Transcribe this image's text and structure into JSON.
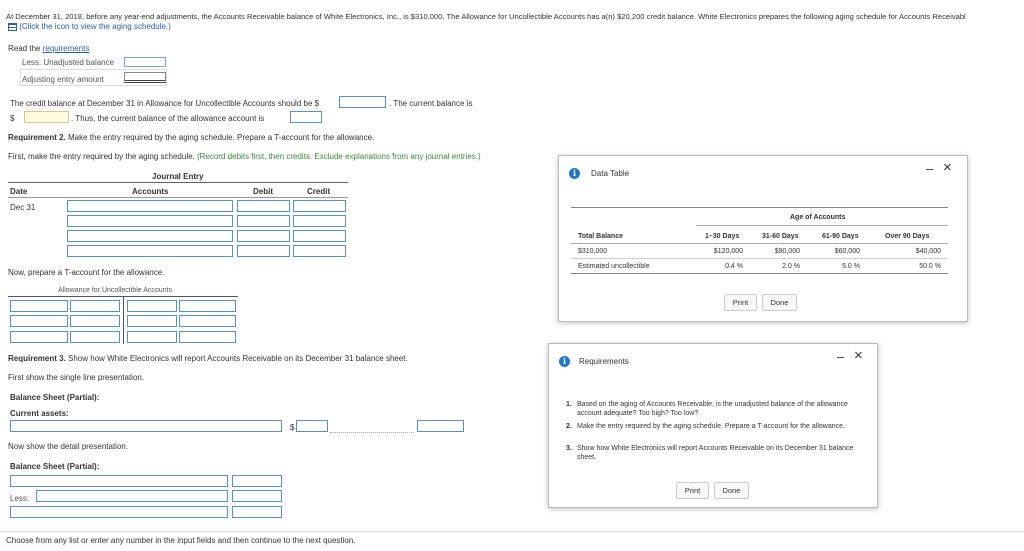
{
  "header": {
    "problem_text": "At December 31, 2018, before any year-end adjustments, the Accounts Receivable balance of White Electronics, Inc., is $310,000. The Allowance for Uncollectible Accounts has a(n) $20,200 credit balance. White Electronics prepares the following aging schedule for Accounts Receivabl",
    "icon_link_text": "(Click the icon to view the aging schedule.)",
    "read_label": "Read the ",
    "requirements_link": "requirements"
  },
  "req1": {
    "less_unadjusted": "Less: Unadjusted balance",
    "adjusting_entry": "Adjusting entry amount",
    "credit_balance_text": "The credit balance at December 31 in Allowance for Uncollectible Accounts should be $",
    "current_balance_text": ". The current balance is",
    "dollar": "$",
    "thus_text": ". Thus, the current balance of the allowance account is"
  },
  "req2": {
    "heading_bold": "Requirement 2.",
    "heading_rest": " Make the entry required by the aging schedule. Prepare a T-account for the allowance.",
    "instruction_start": "First, make the entry required by the aging schedule. ",
    "instruction_green": "(Record debits first, then credits. Exclude explanations from any journal entries.)",
    "journal_title": "Journal Entry",
    "col_date": "Date",
    "col_accounts": "Accounts",
    "col_debit": "Debit",
    "col_credit": "Credit",
    "date_value": "Dec 31",
    "t_account_text": "Now, prepare a T-account for the allowance.",
    "t_account_title": "Allowance for Uncollectible Accounts"
  },
  "req3": {
    "heading_bold": "Requirement 3.",
    "heading_rest": " Show how White Electronics will report Accounts Receivable on its December 31 balance sheet.",
    "single_line": "First show the single line presentation.",
    "balance_sheet_partial": "Balance Sheet (Partial):",
    "current_assets": "Current assets:",
    "dollar": "$",
    "detail_text": "Now show the detail presentation.",
    "balance_sheet_partial_2": "Balance Sheet (Partial):",
    "less_label": "Less:"
  },
  "footer": {
    "text": "Choose from any list or enter any number in the input fields and then continue to the next question."
  },
  "data_table_dialog": {
    "title": "Data Table",
    "minimize": "–",
    "close": "×",
    "group_header": "Age of Accounts",
    "columns": [
      "Total Balance",
      "1–30 Days",
      "31-60 Days",
      "61-90 Days",
      "Over 90 Days"
    ],
    "row_balance": [
      "$310,000",
      "$120,000",
      "$90,000",
      "$60,000",
      "$40,000"
    ],
    "row_estimated": [
      "Estimated uncollectible",
      "0.4 %",
      "2.0 %",
      "5.0 %",
      "50.0 %"
    ],
    "print": "Print",
    "done": "Done"
  },
  "requirements_dialog": {
    "title": "Requirements",
    "minimize": "–",
    "close": "×",
    "items": [
      {
        "num": "1.",
        "text": "Based on the aging of Accounts Receivable, is the unadjusted balance of the allowance account adequate? Too high? Too low?"
      },
      {
        "num": "2.",
        "text": "Make the entry required by the aging schedule. Prepare a T-account for the allowance."
      },
      {
        "num": "3.",
        "text": "Show how White Electronics will report Accounts Receivable on its December 31 balance sheet."
      }
    ],
    "print": "Print",
    "done": "Done"
  },
  "colors": {
    "link": "#2a62b0",
    "instruction_green": "#3a8a3a",
    "info_icon": "#2277c4",
    "input_border": "#7fa3c8"
  }
}
